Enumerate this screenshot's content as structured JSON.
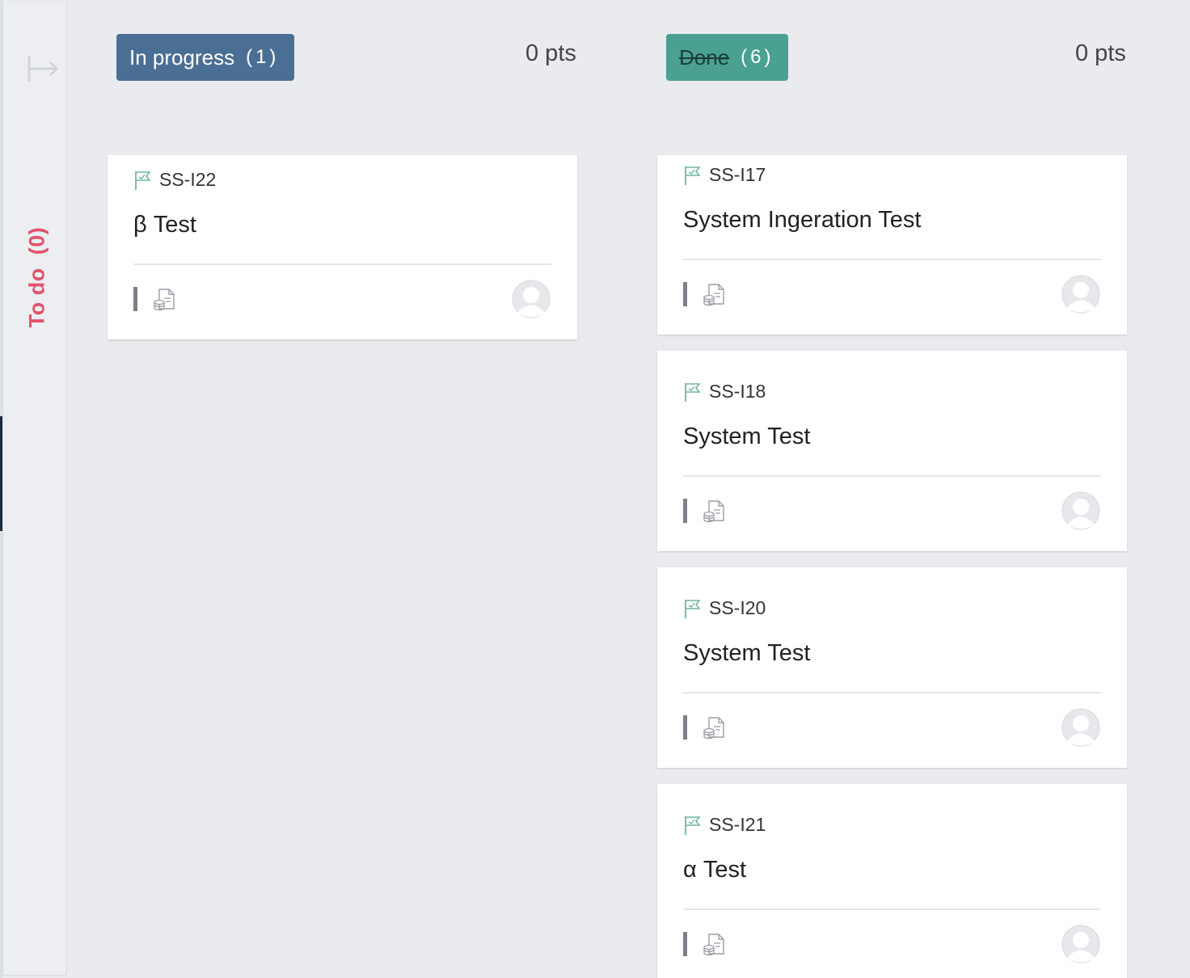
{
  "todo": {
    "label": "To do",
    "count": "(0)"
  },
  "columns": [
    {
      "label": "In progress",
      "count": "(1)",
      "points": "0 pts",
      "color": "#4b6f94"
    },
    {
      "label": "Done",
      "count": "(6)",
      "points": "0 pts",
      "color": "#4aa191"
    }
  ],
  "cards": [
    {
      "id": "SS-I22",
      "title": "β Test"
    },
    {
      "id": "SS-I17",
      "title": "System Ingeration Test"
    },
    {
      "id": "SS-I18",
      "title": "System Test"
    },
    {
      "id": "SS-I20",
      "title": "System Test"
    },
    {
      "id": "SS-I21",
      "title": "α Test"
    }
  ],
  "icons": {
    "expand": "expand-column-icon",
    "flag": "flag-icon",
    "doc": "document-icon",
    "avatar": "avatar-icon"
  }
}
